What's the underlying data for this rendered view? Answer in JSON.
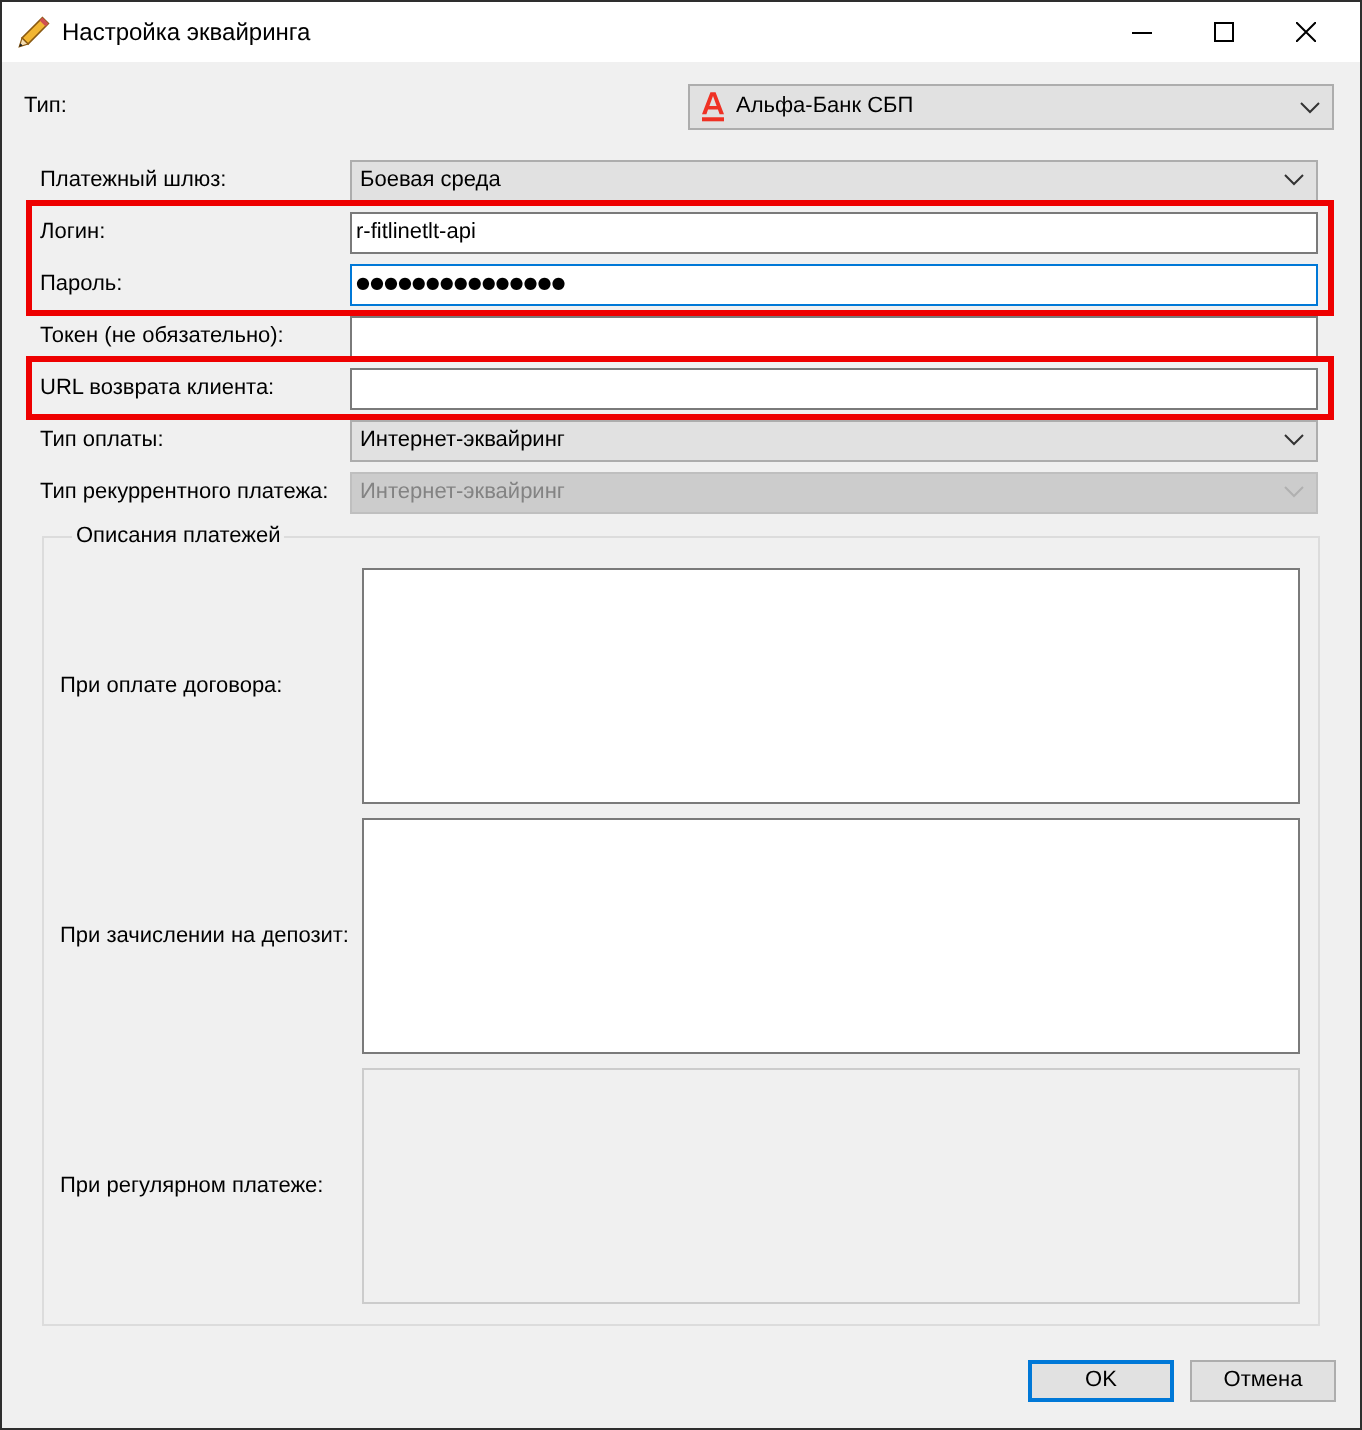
{
  "window": {
    "title": "Настройка эквайринга"
  },
  "type_field": {
    "label": "Тип:",
    "value": "Альфа-Банк СБП"
  },
  "sections": [
    {
      "highlighted": false,
      "fields": [
        {
          "kind": "select",
          "label": "Платежный шлюз:",
          "value": "Боевая среда",
          "focused": false,
          "disabled": false
        }
      ]
    },
    {
      "highlighted": true,
      "fields": [
        {
          "kind": "text",
          "label": "Логин:",
          "value": "r-fitlinetlt-api",
          "focused": false,
          "disabled": false
        },
        {
          "kind": "password",
          "label": "Пароль:",
          "value": "●●●●●●●●●●●●●●●",
          "focused": true,
          "disabled": false
        }
      ]
    },
    {
      "highlighted": false,
      "fields": [
        {
          "kind": "text",
          "label": "Токен (не обязательно):",
          "focused": false,
          "disabled": false
        }
      ]
    },
    {
      "highlighted": true,
      "fields": [
        {
          "kind": "text",
          "label": "URL возврата клиента:",
          "focused": false,
          "disabled": false
        }
      ]
    },
    {
      "highlighted": false,
      "fields": [
        {
          "kind": "select",
          "label": "Тип оплаты:",
          "value": "Интернет-эквайринг",
          "focused": false,
          "disabled": false
        },
        {
          "kind": "select",
          "label": "Тип рекуррентного платежа:",
          "value": "Интернет-эквайринг",
          "focused": false,
          "disabled": true
        }
      ]
    }
  ],
  "descriptions": {
    "title": "Описания платежей",
    "fields": [
      {
        "label": "При оплате договора:",
        "disabled": false
      },
      {
        "label": "При зачислении на депозит:",
        "disabled": false
      },
      {
        "label": "При регулярном платеже:",
        "disabled": true
      }
    ]
  },
  "buttons": [
    {
      "label": "OK",
      "default": true
    },
    {
      "label": "Отмена",
      "default": false
    }
  ]
}
